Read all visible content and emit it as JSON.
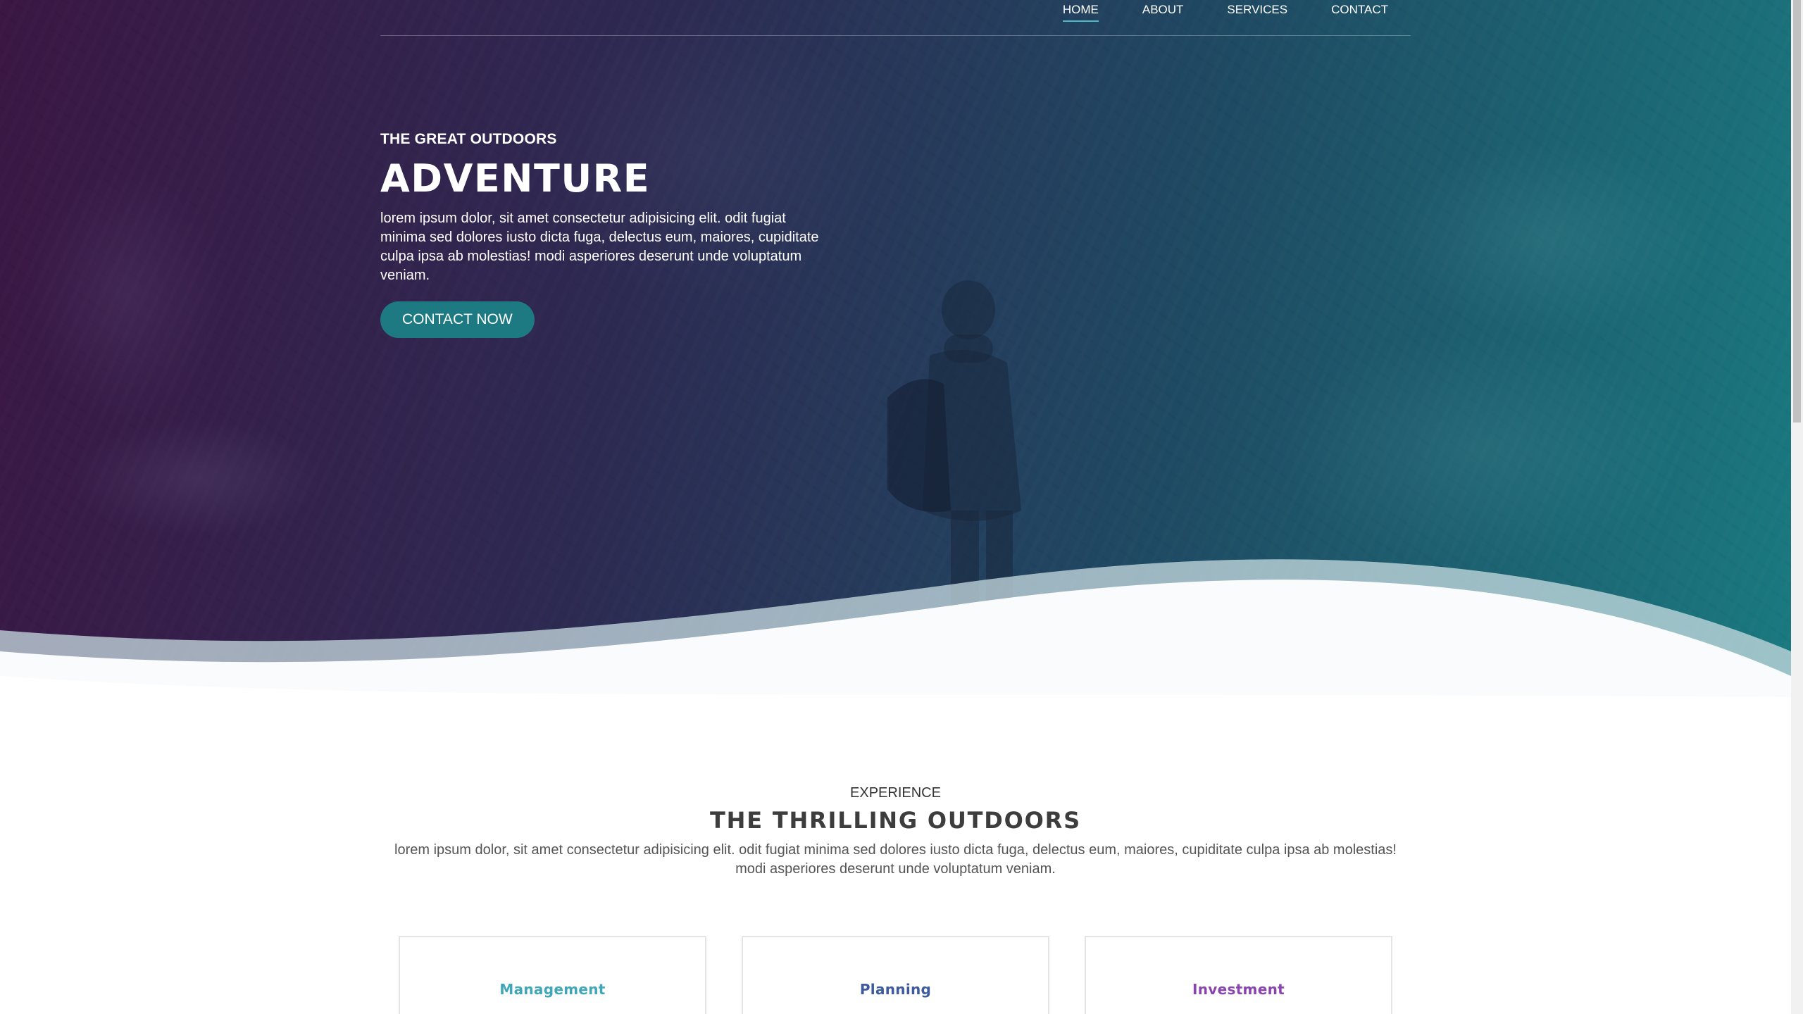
{
  "nav": {
    "items": [
      {
        "label": "HOME",
        "active": true
      },
      {
        "label": "ABOUT",
        "active": false
      },
      {
        "label": "SERVICES",
        "active": false
      },
      {
        "label": "CONTACT",
        "active": false
      }
    ]
  },
  "hero": {
    "eyebrow": "THE GREAT OUTDOORS",
    "title": "ADVENTURE",
    "text": "lorem ipsum dolor, sit amet consectetur adipisicing elit. odit fugiat minima sed dolores iusto dicta fuga, delectus eum, maiores, cupiditate culpa ipsa ab molestias! modi asperiores deserunt unde voluptatum veniam.",
    "cta_label": "CONTACT NOW"
  },
  "experience": {
    "eyebrow": "EXPERIENCE",
    "title": "THE THRILLING OUTDOORS",
    "text": "lorem ipsum dolor, sit amet consectetur adipisicing elit. odit fugiat minima sed dolores iusto dicta fuga, delectus eum, maiores, cupiditate culpa ipsa ab molestias! modi asperiores deserunt unde voluptatum veniam."
  },
  "cards": [
    {
      "title": "Management",
      "color": "#3fa7b8"
    },
    {
      "title": "Planning",
      "color": "#3d5a9e"
    },
    {
      "title": "Investment",
      "color": "#8a44b0"
    }
  ],
  "colors": {
    "accent": "#1e7a82",
    "nav_underline": "#4bbcc4"
  }
}
